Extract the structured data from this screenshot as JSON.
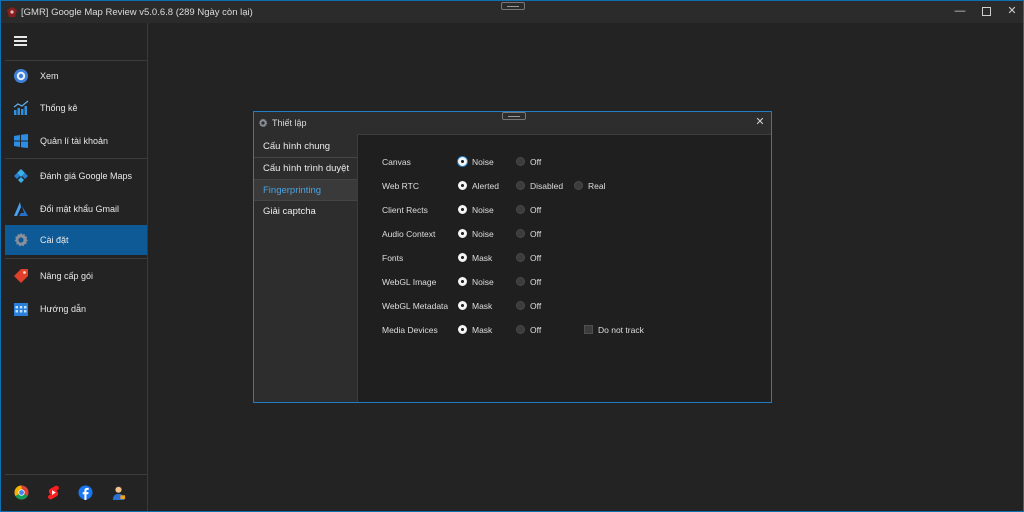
{
  "app": {
    "title": "[GMR] Google Map Review v5.0.6.8 (289 Ngày còn lại)",
    "accent_color": "#0e5a97",
    "window_buttons": [
      "minimize",
      "maximize",
      "close"
    ]
  },
  "sidebar": {
    "menu_icon": "hamburger-icon",
    "items": [
      {
        "label": "Xem",
        "icon": "view-icon"
      },
      {
        "label": "Thống kê",
        "icon": "stats-icon"
      },
      {
        "label": "Quản lí tài khoản",
        "icon": "windows-icon"
      },
      {
        "label": "Đánh giá Google Maps",
        "icon": "kodi-icon"
      },
      {
        "label": "Đổi mật khẩu Gmail",
        "icon": "arrow-a-icon"
      },
      {
        "label": "Cài đặt",
        "icon": "gear-icon",
        "active": true
      },
      {
        "label": "Nâng cấp gói",
        "icon": "tag-icon"
      },
      {
        "label": "Hướng dẫn",
        "icon": "grid-calendar-icon"
      }
    ],
    "bottom_icons": [
      "chrome-icon",
      "youtube-shorts-icon",
      "facebook-icon",
      "support-agent-icon"
    ]
  },
  "dialog": {
    "title": "Thiết lập",
    "tabs": [
      {
        "label": "Cấu hình chung"
      },
      {
        "label": "Cấu hình trình duyệt"
      },
      {
        "label": "Fingerprinting",
        "active": true
      },
      {
        "label": "Giải captcha"
      }
    ],
    "settings": [
      {
        "label": "Canvas",
        "options": [
          "Noise",
          "Off"
        ],
        "selected": "Noise"
      },
      {
        "label": "Web RTC",
        "options": [
          "Alerted",
          "Disabled",
          "Real"
        ],
        "selected": "Alerted"
      },
      {
        "label": "Client Rects",
        "options": [
          "Noise",
          "Off"
        ],
        "selected": "Noise"
      },
      {
        "label": "Audio Context",
        "options": [
          "Noise",
          "Off"
        ],
        "selected": "Noise"
      },
      {
        "label": "Fonts",
        "options": [
          "Mask",
          "Off"
        ],
        "selected": "Mask"
      },
      {
        "label": "WebGL Image",
        "options": [
          "Noise",
          "Off"
        ],
        "selected": "Noise"
      },
      {
        "label": "WebGL Metadata",
        "options": [
          "Mask",
          "Off"
        ],
        "selected": "Mask"
      },
      {
        "label": "Media Devices",
        "options": [
          "Mask",
          "Off"
        ],
        "selected": "Mask"
      }
    ],
    "do_not_track": {
      "label": "Do not track",
      "checked": false
    }
  }
}
